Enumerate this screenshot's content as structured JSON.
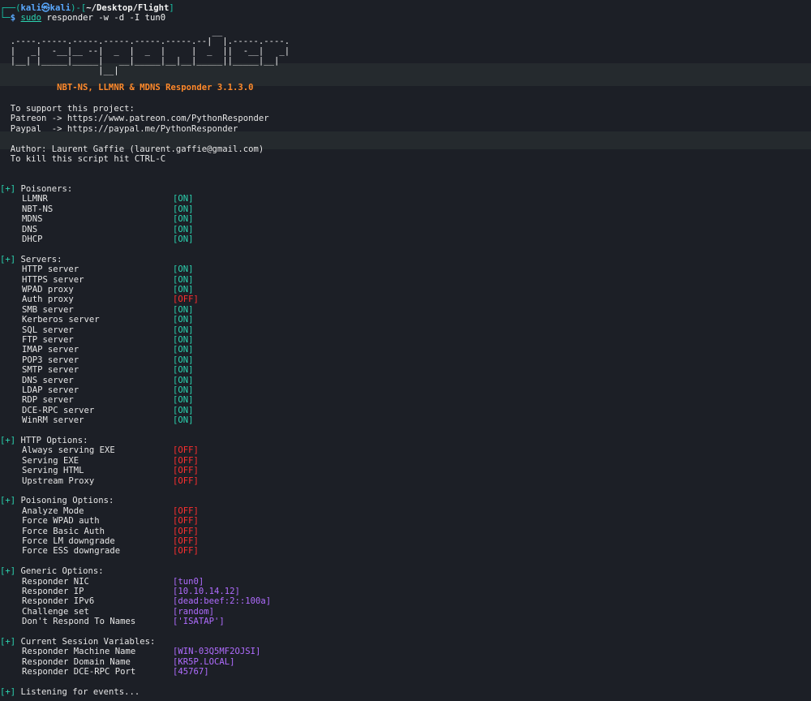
{
  "prompt": {
    "corner1": "┌──(",
    "user": "kali",
    "at": "㉿",
    "host": "kali",
    "mid": ")-[",
    "path": "~/Desktop/Flight",
    "end": "]",
    "corner2": "└─",
    "dollar": "$",
    "cmd_sudo": "sudo",
    "cmd_rest": "responder -w -d -I tun0"
  },
  "banner": {
    "art": [
      "                                         __",
      "  .----.-----.-----.-----.-----.-----.--|  |.-----.----.",
      "  |   _|  -__|__ --|  _  |  _  |     |  _  ||  -__|   _|",
      "  |__| |_____|_____|   __|_____|__|__|_____||_____|__|",
      "                   |__|"
    ],
    "title": "           NBT-NS, LLMNR & MDNS Responder 3.1.3.0"
  },
  "info": [
    "  To support this project:",
    "  Patreon -> https://www.patreon.com/PythonResponder",
    "  Paypal  -> https://paypal.me/PythonResponder",
    "",
    "  Author: Laurent Gaffie (laurent.gaffie@gmail.com)",
    "  To kill this script hit CTRL-C"
  ],
  "sections": [
    {
      "header": "Poisoners:",
      "items": [
        {
          "label": "LLMNR",
          "value": "[ON]",
          "kind": "on"
        },
        {
          "label": "NBT-NS",
          "value": "[ON]",
          "kind": "on"
        },
        {
          "label": "MDNS",
          "value": "[ON]",
          "kind": "on"
        },
        {
          "label": "DNS",
          "value": "[ON]",
          "kind": "on"
        },
        {
          "label": "DHCP",
          "value": "[ON]",
          "kind": "on"
        }
      ]
    },
    {
      "header": "Servers:",
      "items": [
        {
          "label": "HTTP server",
          "value": "[ON]",
          "kind": "on"
        },
        {
          "label": "HTTPS server",
          "value": "[ON]",
          "kind": "on"
        },
        {
          "label": "WPAD proxy",
          "value": "[ON]",
          "kind": "on"
        },
        {
          "label": "Auth proxy",
          "value": "[OFF]",
          "kind": "off"
        },
        {
          "label": "SMB server",
          "value": "[ON]",
          "kind": "on"
        },
        {
          "label": "Kerberos server",
          "value": "[ON]",
          "kind": "on"
        },
        {
          "label": "SQL server",
          "value": "[ON]",
          "kind": "on"
        },
        {
          "label": "FTP server",
          "value": "[ON]",
          "kind": "on"
        },
        {
          "label": "IMAP server",
          "value": "[ON]",
          "kind": "on"
        },
        {
          "label": "POP3 server",
          "value": "[ON]",
          "kind": "on"
        },
        {
          "label": "SMTP server",
          "value": "[ON]",
          "kind": "on"
        },
        {
          "label": "DNS server",
          "value": "[ON]",
          "kind": "on"
        },
        {
          "label": "LDAP server",
          "value": "[ON]",
          "kind": "on"
        },
        {
          "label": "RDP server",
          "value": "[ON]",
          "kind": "on"
        },
        {
          "label": "DCE-RPC server",
          "value": "[ON]",
          "kind": "on"
        },
        {
          "label": "WinRM server",
          "value": "[ON]",
          "kind": "on"
        }
      ]
    },
    {
      "header": "HTTP Options:",
      "items": [
        {
          "label": "Always serving EXE",
          "value": "[OFF]",
          "kind": "off"
        },
        {
          "label": "Serving EXE",
          "value": "[OFF]",
          "kind": "off"
        },
        {
          "label": "Serving HTML",
          "value": "[OFF]",
          "kind": "off"
        },
        {
          "label": "Upstream Proxy",
          "value": "[OFF]",
          "kind": "off"
        }
      ]
    },
    {
      "header": "Poisoning Options:",
      "items": [
        {
          "label": "Analyze Mode",
          "value": "[OFF]",
          "kind": "off"
        },
        {
          "label": "Force WPAD auth",
          "value": "[OFF]",
          "kind": "off"
        },
        {
          "label": "Force Basic Auth",
          "value": "[OFF]",
          "kind": "off"
        },
        {
          "label": "Force LM downgrade",
          "value": "[OFF]",
          "kind": "off"
        },
        {
          "label": "Force ESS downgrade",
          "value": "[OFF]",
          "kind": "off"
        }
      ]
    },
    {
      "header": "Generic Options:",
      "items": [
        {
          "label": "Responder NIC",
          "value": "[tun0]",
          "kind": "val"
        },
        {
          "label": "Responder IP",
          "value": "[10.10.14.12]",
          "kind": "val"
        },
        {
          "label": "Responder IPv6",
          "value": "[dead:beef:2::100a]",
          "kind": "val"
        },
        {
          "label": "Challenge set",
          "value": "[random]",
          "kind": "val"
        },
        {
          "label": "Don't Respond To Names",
          "value": "['ISATAP']",
          "kind": "val"
        }
      ]
    },
    {
      "header": "Current Session Variables:",
      "items": [
        {
          "label": "Responder Machine Name",
          "value": "[WIN-03Q5MF2OJSI]",
          "kind": "val"
        },
        {
          "label": "Responder Domain Name",
          "value": "[KR5P.LOCAL]",
          "kind": "val"
        },
        {
          "label": "Responder DCE-RPC Port",
          "value": "[45767]",
          "kind": "val"
        }
      ]
    }
  ],
  "plus_tag": "[+]",
  "footer": "Listening for events...",
  "colors": {
    "background": "#1c1f26",
    "on": "#2bd3b0",
    "off": "#ff2f2f",
    "value": "#b06cff",
    "title": "#ff8a2b"
  }
}
